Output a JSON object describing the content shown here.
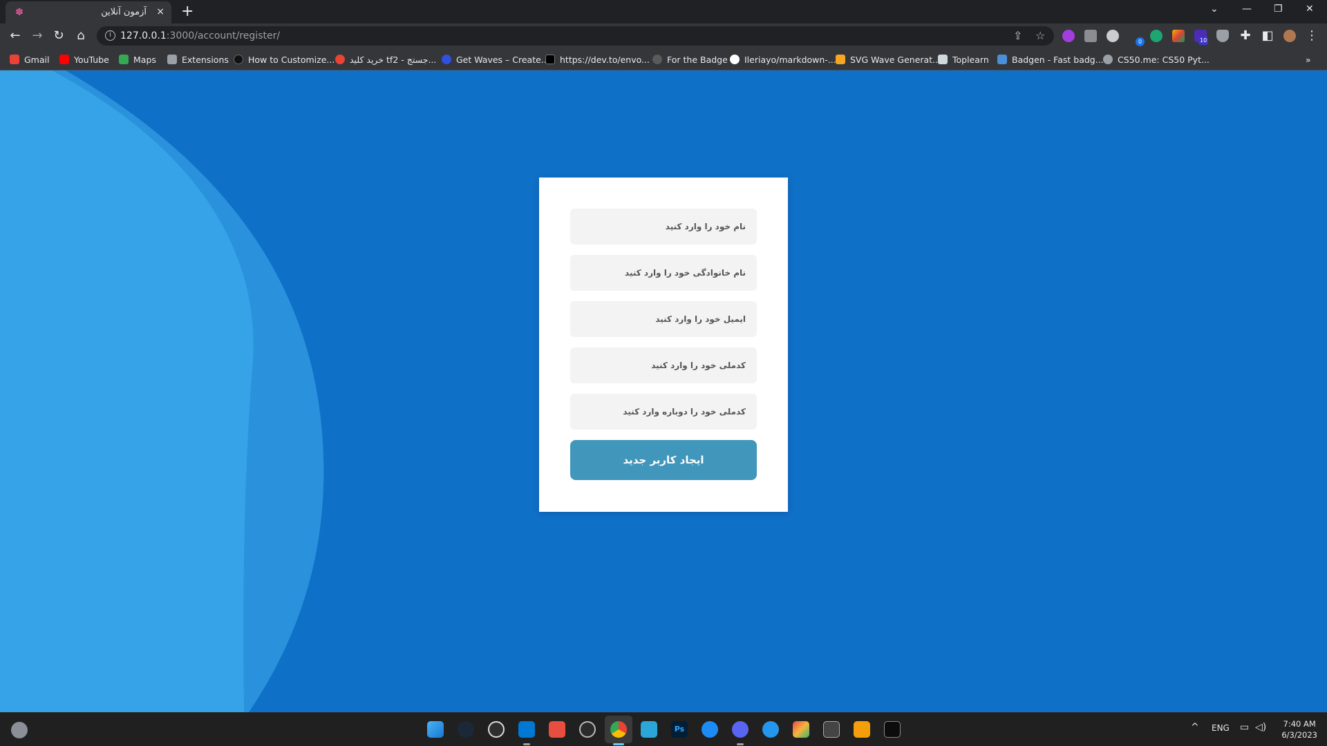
{
  "browser": {
    "tab_title": "آزمون آنلاین",
    "tab_close": "×",
    "new_tab": "+",
    "url_host": "127.0.0.1",
    "url_rest": ":3000/account/register/",
    "nav": {
      "back": "←",
      "forward": "→",
      "reload": "↻",
      "home": "⌂"
    }
  },
  "bookmarks": [
    {
      "label": "Gmail",
      "icon": "gmail-icon",
      "color": "#ea4335"
    },
    {
      "label": "YouTube",
      "icon": "youtube-icon",
      "color": "#ff0000"
    },
    {
      "label": "Maps",
      "icon": "maps-icon",
      "color": "#34a853"
    },
    {
      "label": "Extensions",
      "icon": "puzzle-icon",
      "color": "#9aa0a6"
    },
    {
      "label": "How to Customize...",
      "icon": "site-icon",
      "color": "#111111"
    },
    {
      "label": "خرید کلید tf2 - جستج...",
      "icon": "google-icon",
      "color": "#ea4335"
    },
    {
      "label": "Get Waves – Create...",
      "icon": "waves-icon",
      "color": "#3050e0"
    },
    {
      "label": "https://dev.to/envo...",
      "icon": "dev-icon",
      "color": "#000000"
    },
    {
      "label": "For the Badge",
      "icon": "badge-icon",
      "color": "#5a5a5a"
    },
    {
      "label": "Ileriayo/markdown-...",
      "icon": "github-icon",
      "color": "#ffffff"
    },
    {
      "label": "SVG Wave Generat...",
      "icon": "svgwave-icon",
      "color": "#f5a623"
    },
    {
      "label": "Toplearn",
      "icon": "toplearn-icon",
      "color": "#cfd8dc"
    },
    {
      "label": "Badgen - Fast badg...",
      "icon": "badgen-icon",
      "color": "#4a90d9"
    },
    {
      "label": "CS50.me: CS50 Pyt...",
      "icon": "globe-icon",
      "color": "#9aa0a6"
    }
  ],
  "bookmarks_overflow": "»",
  "form": {
    "first_name_placeholder": "نام خود را وارد کنید",
    "last_name_placeholder": "نام خانوادگی خود را وارد کنید",
    "email_placeholder": "ایمیل خود را وارد کنید",
    "national_code_placeholder": "کدملی خود را وارد کنید",
    "national_code_repeat_placeholder": "کدملی خود را دوباره وارد کنید",
    "submit_label": "ایجاد کاربر جدید",
    "submit_color": "#4096bb"
  },
  "colors": {
    "page_bg": "#0f70c8",
    "wave_light": "#36a3e8",
    "wave_mid": "#2a92dc"
  },
  "extensions_badges": {
    "badge_a": "0",
    "badge_b": "10"
  },
  "taskbar": {
    "apps": [
      "windows-start-icon",
      "steam-icon",
      "obs-icon",
      "vscode-icon",
      "git-icon",
      "unity-icon",
      "chrome-icon",
      "remote-desktop-icon",
      "photoshop-icon",
      "app-store-icon",
      "discord-icon",
      "docker-icon",
      "visual-studio-icon",
      "terminal-server-icon",
      "stack-icon",
      "terminal-icon"
    ],
    "photoshop_label": "Ps",
    "tray_chevron": "^",
    "language": "ENG",
    "time": "7:40 AM",
    "date": "6/3/2023"
  }
}
